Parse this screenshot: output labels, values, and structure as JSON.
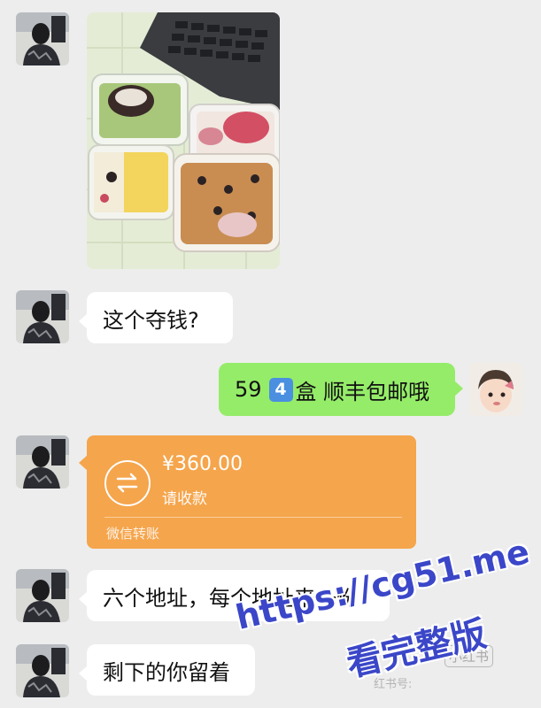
{
  "messages": {
    "question": "这个夺钱?",
    "reply_price": "59",
    "reply_count_badge": "4",
    "reply_rest": "盒 顺丰包邮哦",
    "address_msg": "六个地址，每个地址来一份",
    "keep_msg": "剩下的你留着"
  },
  "transfer": {
    "amount": "¥360.00",
    "status": "请收款",
    "footer": "微信转账",
    "color": "#f5a54c"
  },
  "watermark": {
    "url": "https://cg51.me",
    "caption": "看完整版",
    "small_logo": "小红书",
    "faded_text": "红书号:"
  },
  "colors": {
    "background": "#ededed",
    "sent_bubble": "#95ec69",
    "received_bubble": "#ffffff",
    "watermark": "#3b47c8"
  }
}
